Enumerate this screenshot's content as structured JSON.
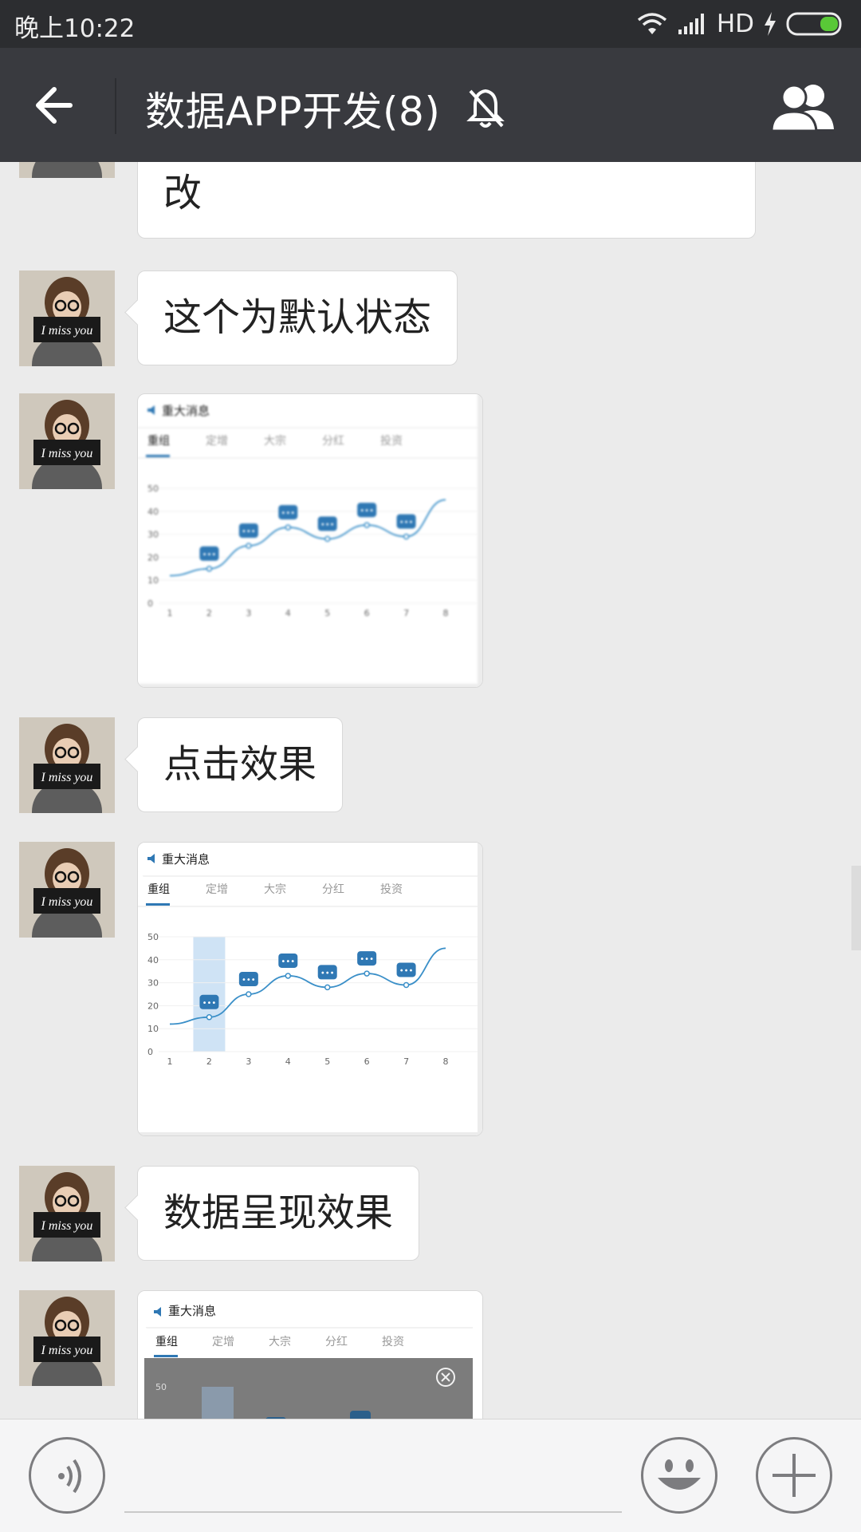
{
  "status_bar": {
    "time": "晚上10:22",
    "network": "HD"
  },
  "nav": {
    "title": "数据APP开发(8)",
    "icons": [
      "back-arrow-icon",
      "mute-bell-icon",
      "group-members-icon"
    ]
  },
  "messages": [
    {
      "type": "text",
      "text": "改"
    },
    {
      "type": "text",
      "text": "这个为默认状态"
    },
    {
      "type": "image"
    },
    {
      "type": "text",
      "text": "点击效果"
    },
    {
      "type": "image"
    },
    {
      "type": "text",
      "text": "数据呈现效果"
    },
    {
      "type": "image"
    }
  ],
  "avatar_caption": "I miss you",
  "chart_card": {
    "heading": "重大消息",
    "tabs": [
      "重组",
      "定增",
      "大宗",
      "分红",
      "投资"
    ]
  },
  "chart_data": [
    {
      "type": "line",
      "x": [
        1,
        2,
        3,
        4,
        5,
        6,
        7,
        8
      ],
      "series": [
        {
          "values": [
            12,
            15,
            25,
            33,
            28,
            34,
            29,
            45
          ]
        }
      ],
      "ylim": [
        0,
        50
      ],
      "yticks": [
        0,
        10,
        20,
        30,
        40,
        50
      ],
      "markers_at_x": [
        2,
        3,
        4,
        5,
        6,
        7
      ],
      "marker_label": "•••"
    },
    {
      "type": "line",
      "x": [
        1,
        2,
        3,
        4,
        5,
        6,
        7,
        8
      ],
      "series": [
        {
          "values": [
            12,
            15,
            25,
            33,
            28,
            34,
            29,
            45
          ]
        }
      ],
      "ylim": [
        0,
        50
      ],
      "yticks": [
        0,
        10,
        20,
        30,
        40,
        50
      ],
      "markers_at_x": [
        2,
        3,
        4,
        5,
        6,
        7
      ],
      "highlight_x": 2,
      "marker_label": "•••"
    }
  ],
  "colors": {
    "nav_bg": "#393a3f",
    "status_bg": "#2c2d30",
    "chat_bg": "#ebebeb",
    "line": "#3a8fc8",
    "marker": "#2f78b4",
    "highlight": "#cfe3f5",
    "tab_active": "#2f78b4",
    "battery": "#59c837"
  },
  "bottom_bar": {
    "left_icon": "voice-icon",
    "right_icons": [
      "emoji-icon",
      "plus-icon"
    ]
  }
}
